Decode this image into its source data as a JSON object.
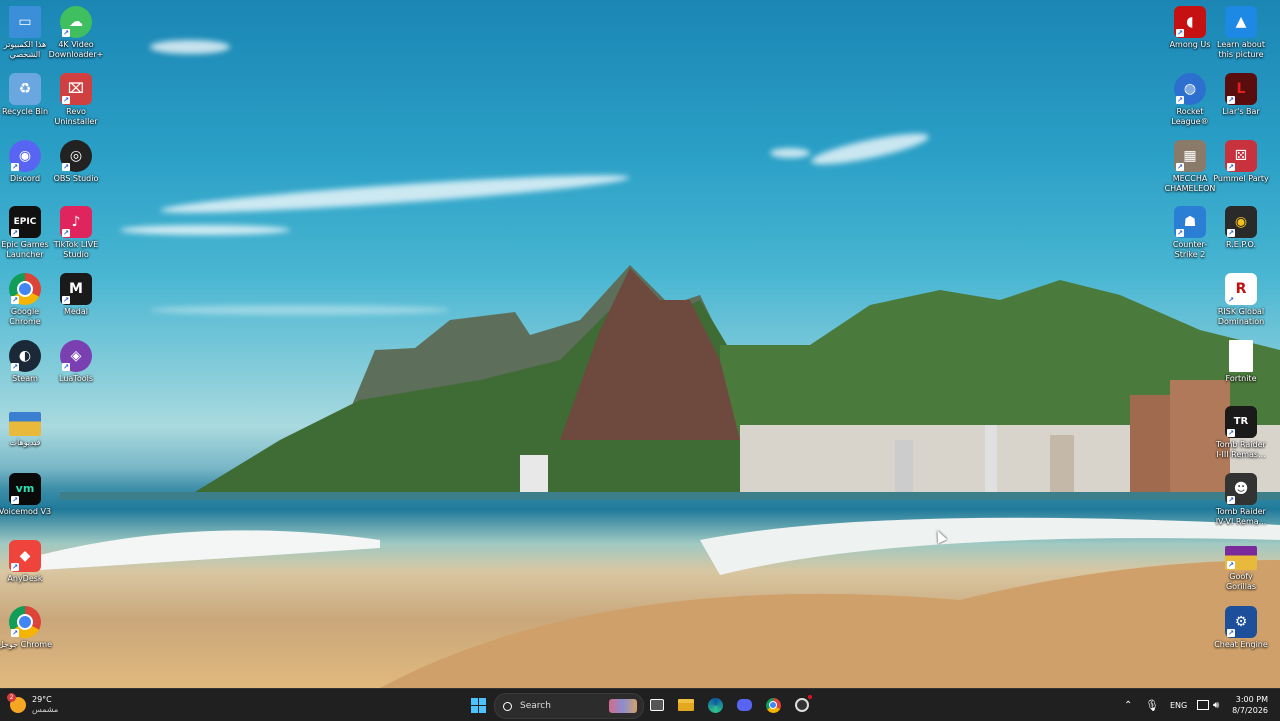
{
  "desktop": {
    "left_icons": [
      {
        "label": "هذا الكمبيوتر الشخصي",
        "icon": "this-pc-icon",
        "color": "#3a8fd8",
        "glyph": "▭"
      },
      {
        "label": "4K Video Downloader+",
        "icon": "4k-video-downloader-icon",
        "color": "#3fbf5f",
        "glyph": "☁"
      },
      {
        "label": "Recycle Bin",
        "icon": "recycle-bin-icon",
        "color": "#6aa6e0",
        "glyph": "♻"
      },
      {
        "label": "Revo Uninstaller",
        "icon": "revo-uninstaller-icon",
        "color": "#d04040",
        "glyph": "⌧"
      },
      {
        "label": "Discord",
        "icon": "discord-icon",
        "color": "#5865f2",
        "glyph": "◉"
      },
      {
        "label": "OBS Studio",
        "icon": "obs-studio-icon",
        "color": "#222222",
        "glyph": "◎"
      },
      {
        "label": "Epic Games Launcher",
        "icon": "epic-games-icon",
        "color": "#111111",
        "glyph": "EPIC"
      },
      {
        "label": "TikTok LIVE Studio",
        "icon": "tiktok-live-studio-icon",
        "color": "#e0245e",
        "glyph": "♪"
      },
      {
        "label": "Google Chrome",
        "icon": "google-chrome-icon",
        "color": "#ffffff",
        "glyph": "◉"
      },
      {
        "label": "Medal",
        "icon": "medal-icon",
        "color": "#1a1a1a",
        "glyph": "M"
      },
      {
        "label": "Steam",
        "icon": "steam-icon",
        "color": "#1b2838",
        "glyph": "◐"
      },
      {
        "label": "LuaTools",
        "icon": "luatools-icon",
        "color": "#7a3fb0",
        "glyph": "◈"
      },
      {
        "label": "فيديوهات",
        "icon": "folder-icon",
        "color": "#e8b93a",
        "glyph": "▬"
      },
      {
        "label": "Voicemod V3",
        "icon": "voicemod-icon",
        "color": "#0a0a0a",
        "glyph": "vm"
      },
      {
        "label": "AnyDesk",
        "icon": "anydesk-icon",
        "color": "#ef443b",
        "glyph": "◆"
      },
      {
        "label": "جوجل Chrome",
        "icon": "google-chrome-icon",
        "color": "#ffffff",
        "glyph": "◉"
      }
    ],
    "right_icons": [
      {
        "label": "Among Us",
        "icon": "among-us-icon",
        "color": "#c51111",
        "glyph": "◖"
      },
      {
        "label": "Learn about this picture",
        "icon": "learn-about-picture-icon",
        "color": "#1e88e5",
        "glyph": "▲"
      },
      {
        "label": "Rocket League®",
        "icon": "rocket-league-icon",
        "color": "#2d6fcf",
        "glyph": "◍"
      },
      {
        "label": "Liar's Bar",
        "icon": "liars-bar-icon",
        "color": "#5a0d0d",
        "glyph": "L"
      },
      {
        "label": "MECCHA CHAMELEON",
        "icon": "meccha-chameleon-icon",
        "color": "#8a7a6a",
        "glyph": "▦"
      },
      {
        "label": "Pummel Party",
        "icon": "pummel-party-icon",
        "color": "#c8323c",
        "glyph": "⚄"
      },
      {
        "label": "Counter-Strike 2",
        "icon": "counter-strike-icon",
        "color": "#2a7fd4",
        "glyph": "☗"
      },
      {
        "label": "R.E.P.O.",
        "icon": "repo-icon",
        "color": "#2a2a2a",
        "glyph": "◉"
      },
      {
        "label": "RISK Global Domination",
        "icon": "risk-icon",
        "color": "#ffffff",
        "glyph": "R"
      },
      {
        "label": "Fortnite",
        "icon": "fortnite-file-icon",
        "color": "#ffffff",
        "glyph": ""
      },
      {
        "label": "Tomb Raider I-III Remas...",
        "icon": "tomb-raider-icon",
        "color": "#1a1a1a",
        "glyph": "TR"
      },
      {
        "label": "Tomb Raider IV-VI Rema...",
        "icon": "tomb-raider-icon",
        "color": "#333333",
        "glyph": "☻"
      },
      {
        "label": "Goofy Gorillas",
        "icon": "goofy-gorillas-icon",
        "color": "#7a2a9a",
        "glyph": "▬"
      },
      {
        "label": "Cheat Engine",
        "icon": "cheat-engine-icon",
        "color": "#1d4f9a",
        "glyph": "⚙"
      }
    ]
  },
  "taskbar": {
    "weather": {
      "temp": "29°C",
      "condition": "مشمس",
      "badge": "2"
    },
    "search_placeholder": "Search",
    "language": "ENG",
    "time": "3:00 PM",
    "date": "8/7/2026"
  }
}
